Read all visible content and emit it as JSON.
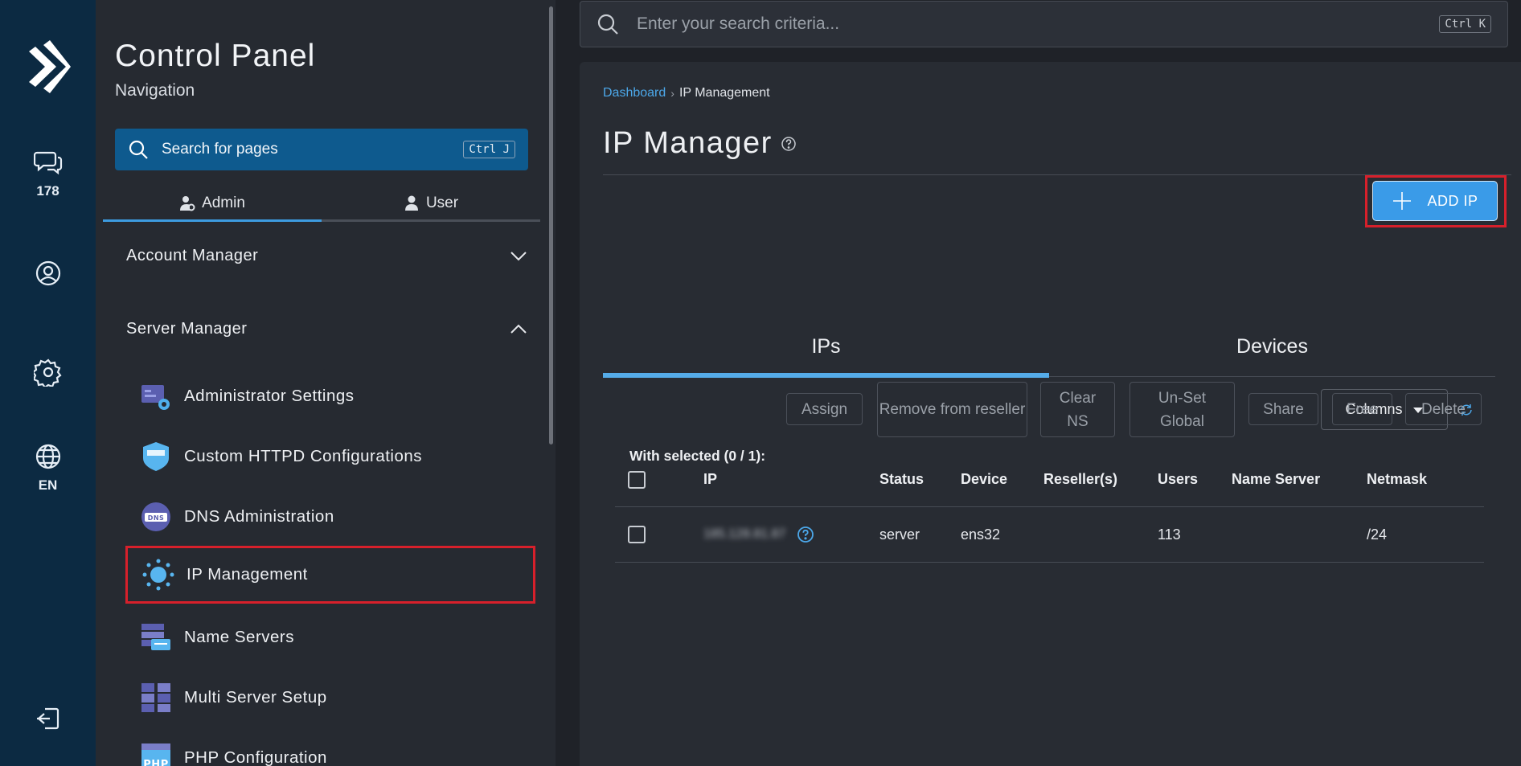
{
  "rail": {
    "chat_count": "178",
    "language": "EN",
    "icons": [
      "logo-icon",
      "chat-icon",
      "user-circle-icon",
      "gear-icon",
      "globe-icon",
      "logout-icon"
    ]
  },
  "nav": {
    "title": "Control Panel",
    "subtitle": "Navigation",
    "search_label": "Search for pages",
    "search_shortcut": "Ctrl J",
    "tabs": [
      {
        "label": "Admin",
        "active": true
      },
      {
        "label": "User",
        "active": false
      }
    ],
    "sections": [
      {
        "label": "Account Manager",
        "expanded": false
      },
      {
        "label": "Server Manager",
        "expanded": true
      }
    ],
    "items": [
      {
        "label": "Administrator Settings",
        "icon": "admin-settings-icon"
      },
      {
        "label": "Custom HTTPD Configurations",
        "icon": "httpd-icon"
      },
      {
        "label": "DNS Administration",
        "icon": "dns-icon"
      },
      {
        "label": "IP Management",
        "icon": "ip-network-icon",
        "selected": true
      },
      {
        "label": "Name Servers",
        "icon": "name-servers-icon"
      },
      {
        "label": "Multi Server Setup",
        "icon": "multi-server-icon"
      },
      {
        "label": "PHP Configuration",
        "icon": "php-icon"
      }
    ]
  },
  "search": {
    "placeholder": "Enter your search criteria...",
    "shortcut": "Ctrl K"
  },
  "main": {
    "breadcrumb": {
      "home": "Dashboard",
      "current": "IP Management"
    },
    "title": "IP Manager",
    "add_button": "ADD IP",
    "tabs": [
      {
        "label": "IPs",
        "active": true
      },
      {
        "label": "Devices",
        "active": false
      }
    ],
    "columns_button": "Columns",
    "with_selected": "With selected (0 / 1):",
    "bulk_actions": [
      "Assign",
      "Remove from reseller",
      "Clear NS",
      "Un-Set Global",
      "Share",
      "Free",
      "Delete"
    ],
    "table": {
      "headers": [
        "IP",
        "Status",
        "Device",
        "Reseller(s)",
        "Users",
        "Name Server",
        "Netmask"
      ],
      "rows": [
        {
          "ip": "185.128.81.87",
          "status": "server",
          "device": "ens32",
          "resellers": "",
          "users": "113",
          "name_server": "",
          "netmask": "/24"
        }
      ]
    }
  },
  "colors": {
    "rail_bg": "#0c2a42",
    "accent": "#3a9be8",
    "highlight": "#d7202b"
  }
}
